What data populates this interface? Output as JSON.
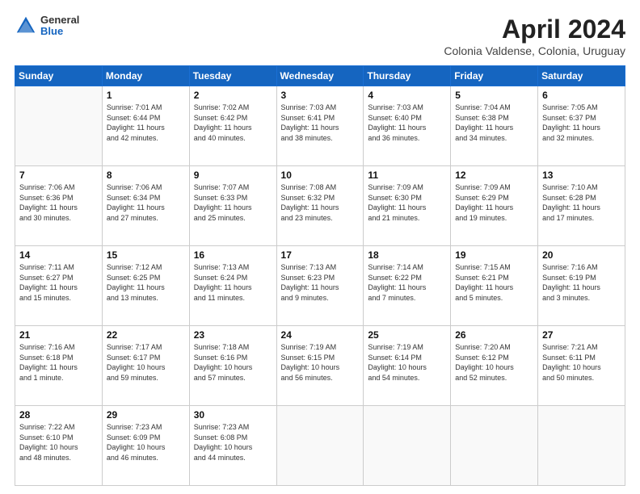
{
  "header": {
    "logo_general": "General",
    "logo_blue": "Blue",
    "month_title": "April 2024",
    "location": "Colonia Valdense, Colonia, Uruguay"
  },
  "days_of_week": [
    "Sunday",
    "Monday",
    "Tuesday",
    "Wednesday",
    "Thursday",
    "Friday",
    "Saturday"
  ],
  "weeks": [
    [
      {
        "day": "",
        "info": ""
      },
      {
        "day": "1",
        "info": "Sunrise: 7:01 AM\nSunset: 6:44 PM\nDaylight: 11 hours\nand 42 minutes."
      },
      {
        "day": "2",
        "info": "Sunrise: 7:02 AM\nSunset: 6:42 PM\nDaylight: 11 hours\nand 40 minutes."
      },
      {
        "day": "3",
        "info": "Sunrise: 7:03 AM\nSunset: 6:41 PM\nDaylight: 11 hours\nand 38 minutes."
      },
      {
        "day": "4",
        "info": "Sunrise: 7:03 AM\nSunset: 6:40 PM\nDaylight: 11 hours\nand 36 minutes."
      },
      {
        "day": "5",
        "info": "Sunrise: 7:04 AM\nSunset: 6:38 PM\nDaylight: 11 hours\nand 34 minutes."
      },
      {
        "day": "6",
        "info": "Sunrise: 7:05 AM\nSunset: 6:37 PM\nDaylight: 11 hours\nand 32 minutes."
      }
    ],
    [
      {
        "day": "7",
        "info": "Sunrise: 7:06 AM\nSunset: 6:36 PM\nDaylight: 11 hours\nand 30 minutes."
      },
      {
        "day": "8",
        "info": "Sunrise: 7:06 AM\nSunset: 6:34 PM\nDaylight: 11 hours\nand 27 minutes."
      },
      {
        "day": "9",
        "info": "Sunrise: 7:07 AM\nSunset: 6:33 PM\nDaylight: 11 hours\nand 25 minutes."
      },
      {
        "day": "10",
        "info": "Sunrise: 7:08 AM\nSunset: 6:32 PM\nDaylight: 11 hours\nand 23 minutes."
      },
      {
        "day": "11",
        "info": "Sunrise: 7:09 AM\nSunset: 6:30 PM\nDaylight: 11 hours\nand 21 minutes."
      },
      {
        "day": "12",
        "info": "Sunrise: 7:09 AM\nSunset: 6:29 PM\nDaylight: 11 hours\nand 19 minutes."
      },
      {
        "day": "13",
        "info": "Sunrise: 7:10 AM\nSunset: 6:28 PM\nDaylight: 11 hours\nand 17 minutes."
      }
    ],
    [
      {
        "day": "14",
        "info": "Sunrise: 7:11 AM\nSunset: 6:27 PM\nDaylight: 11 hours\nand 15 minutes."
      },
      {
        "day": "15",
        "info": "Sunrise: 7:12 AM\nSunset: 6:25 PM\nDaylight: 11 hours\nand 13 minutes."
      },
      {
        "day": "16",
        "info": "Sunrise: 7:13 AM\nSunset: 6:24 PM\nDaylight: 11 hours\nand 11 minutes."
      },
      {
        "day": "17",
        "info": "Sunrise: 7:13 AM\nSunset: 6:23 PM\nDaylight: 11 hours\nand 9 minutes."
      },
      {
        "day": "18",
        "info": "Sunrise: 7:14 AM\nSunset: 6:22 PM\nDaylight: 11 hours\nand 7 minutes."
      },
      {
        "day": "19",
        "info": "Sunrise: 7:15 AM\nSunset: 6:21 PM\nDaylight: 11 hours\nand 5 minutes."
      },
      {
        "day": "20",
        "info": "Sunrise: 7:16 AM\nSunset: 6:19 PM\nDaylight: 11 hours\nand 3 minutes."
      }
    ],
    [
      {
        "day": "21",
        "info": "Sunrise: 7:16 AM\nSunset: 6:18 PM\nDaylight: 11 hours\nand 1 minute."
      },
      {
        "day": "22",
        "info": "Sunrise: 7:17 AM\nSunset: 6:17 PM\nDaylight: 10 hours\nand 59 minutes."
      },
      {
        "day": "23",
        "info": "Sunrise: 7:18 AM\nSunset: 6:16 PM\nDaylight: 10 hours\nand 57 minutes."
      },
      {
        "day": "24",
        "info": "Sunrise: 7:19 AM\nSunset: 6:15 PM\nDaylight: 10 hours\nand 56 minutes."
      },
      {
        "day": "25",
        "info": "Sunrise: 7:19 AM\nSunset: 6:14 PM\nDaylight: 10 hours\nand 54 minutes."
      },
      {
        "day": "26",
        "info": "Sunrise: 7:20 AM\nSunset: 6:12 PM\nDaylight: 10 hours\nand 52 minutes."
      },
      {
        "day": "27",
        "info": "Sunrise: 7:21 AM\nSunset: 6:11 PM\nDaylight: 10 hours\nand 50 minutes."
      }
    ],
    [
      {
        "day": "28",
        "info": "Sunrise: 7:22 AM\nSunset: 6:10 PM\nDaylight: 10 hours\nand 48 minutes."
      },
      {
        "day": "29",
        "info": "Sunrise: 7:23 AM\nSunset: 6:09 PM\nDaylight: 10 hours\nand 46 minutes."
      },
      {
        "day": "30",
        "info": "Sunrise: 7:23 AM\nSunset: 6:08 PM\nDaylight: 10 hours\nand 44 minutes."
      },
      {
        "day": "",
        "info": ""
      },
      {
        "day": "",
        "info": ""
      },
      {
        "day": "",
        "info": ""
      },
      {
        "day": "",
        "info": ""
      }
    ]
  ]
}
